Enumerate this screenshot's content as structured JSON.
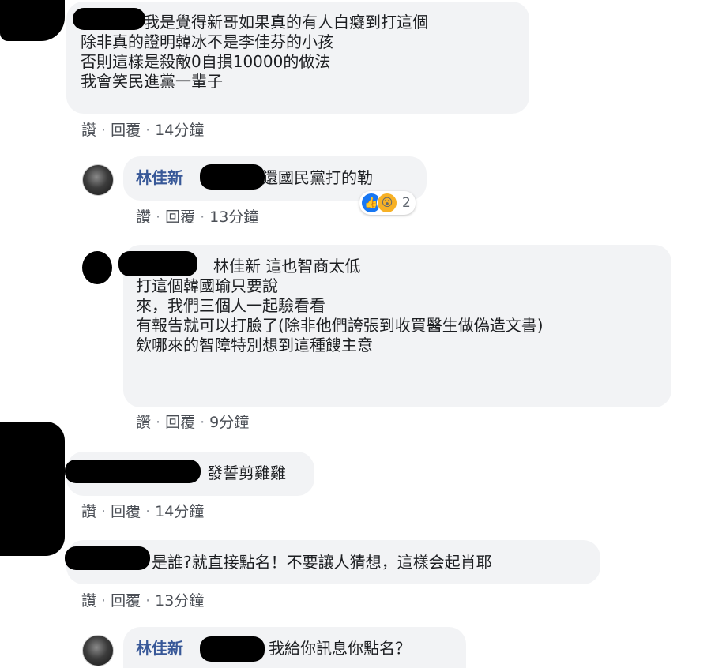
{
  "comments": [
    {
      "lines": [
        "我是覺得新哥如果真的有人白癡到打這個",
        "除非真的證明韓冰不是李佳芬的小孩",
        "否則這樣是殺敵0自損10000的做法",
        "我會笑民進黨一輩子"
      ],
      "actions": {
        "like": "讚",
        "reply": "回覆",
        "time": "14分鐘"
      }
    },
    {
      "name": "林佳新",
      "text": "還國民黨打的勒",
      "reaction_count": "2",
      "actions": {
        "like": "讚",
        "reply": "回覆",
        "time": "13分鐘"
      }
    },
    {
      "tag": "林佳新",
      "first": "這也智商太低",
      "lines": [
        "打這個韓國瑜只要說",
        "來，我們三個人一起驗看看",
        "有報告就可以打臉了(除非他們誇張到收買醫生做偽造文書)",
        "欸哪來的智障特別想到這種餿主意"
      ],
      "actions": {
        "like": "讚",
        "reply": "回覆",
        "time": "9分鐘"
      }
    },
    {
      "text": "發誓剪雞雞",
      "actions": {
        "like": "讚",
        "reply": "回覆",
        "time": "14分鐘"
      }
    },
    {
      "text": "是誰?就直接點名！不要讓人猜想，這樣会起肖耶",
      "actions": {
        "like": "讚",
        "reply": "回覆",
        "time": "13分鐘"
      }
    },
    {
      "name": "林佳新",
      "text": "我給你訊息你點名？"
    }
  ],
  "separator": "·",
  "colors": {
    "bubble": "#f2f3f5",
    "name": "#385898",
    "like": "#1877f2",
    "wow": "#f7b125"
  },
  "icons": [
    "like-reaction-icon",
    "wow-reaction-icon"
  ]
}
